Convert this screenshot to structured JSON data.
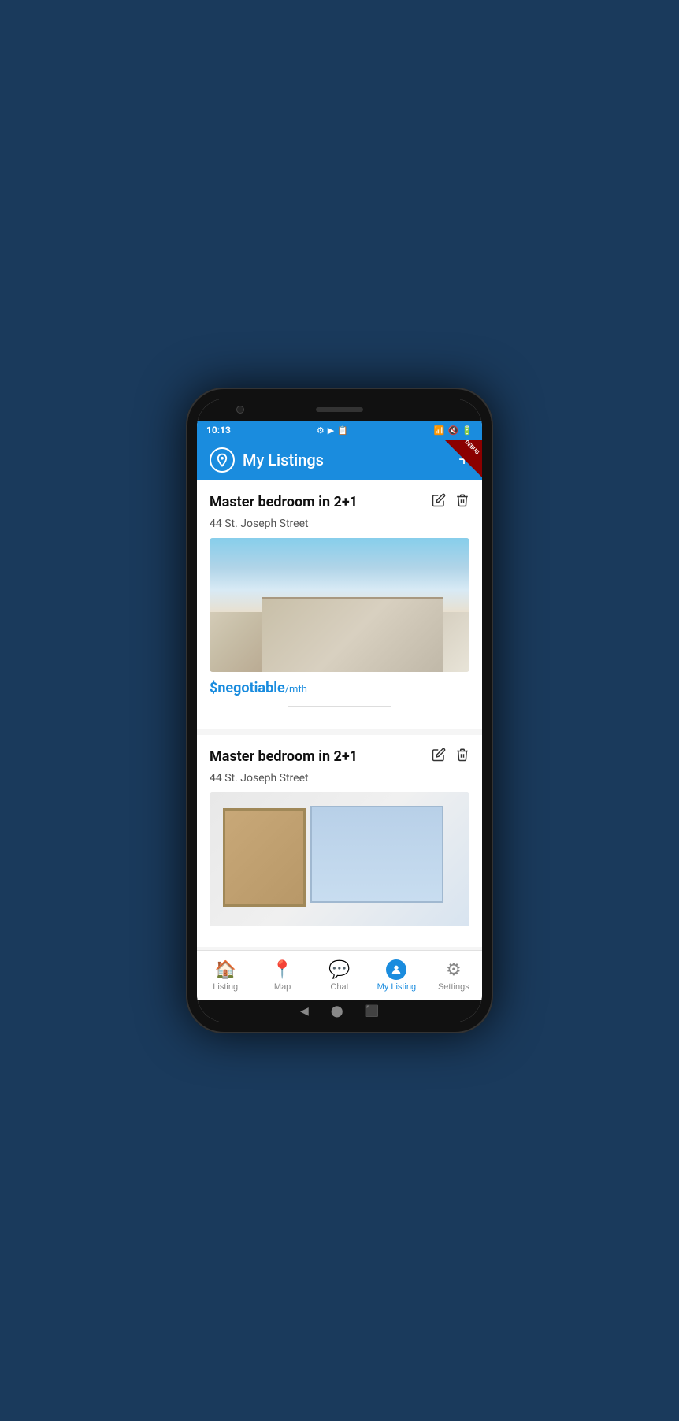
{
  "statusBar": {
    "time": "10:13",
    "icons": [
      "⚙",
      "▶",
      "📋"
    ]
  },
  "header": {
    "title": "My Listings",
    "addButtonLabel": "+",
    "debugLabel": "DEBUG"
  },
  "listings": [
    {
      "id": "listing-1",
      "title": "Master bedroom in 2+1",
      "address": "44 St. Joseph Street",
      "priceText": "$negotiable",
      "priceUnit": "/mth",
      "imageType": "kitchen"
    },
    {
      "id": "listing-2",
      "title": "Master bedroom in 2+1",
      "address": "44 St. Joseph Street",
      "priceText": "",
      "priceUnit": "",
      "imageType": "bedroom"
    }
  ],
  "bottomNav": {
    "items": [
      {
        "id": "listing",
        "label": "Listing",
        "icon": "🏠",
        "active": false
      },
      {
        "id": "map",
        "label": "Map",
        "icon": "📍",
        "active": false
      },
      {
        "id": "chat",
        "label": "Chat",
        "icon": "💬",
        "active": false
      },
      {
        "id": "my-listing",
        "label": "My Listing",
        "icon": "person",
        "active": true
      },
      {
        "id": "settings",
        "label": "Settings",
        "icon": "⚙",
        "active": false
      }
    ]
  }
}
